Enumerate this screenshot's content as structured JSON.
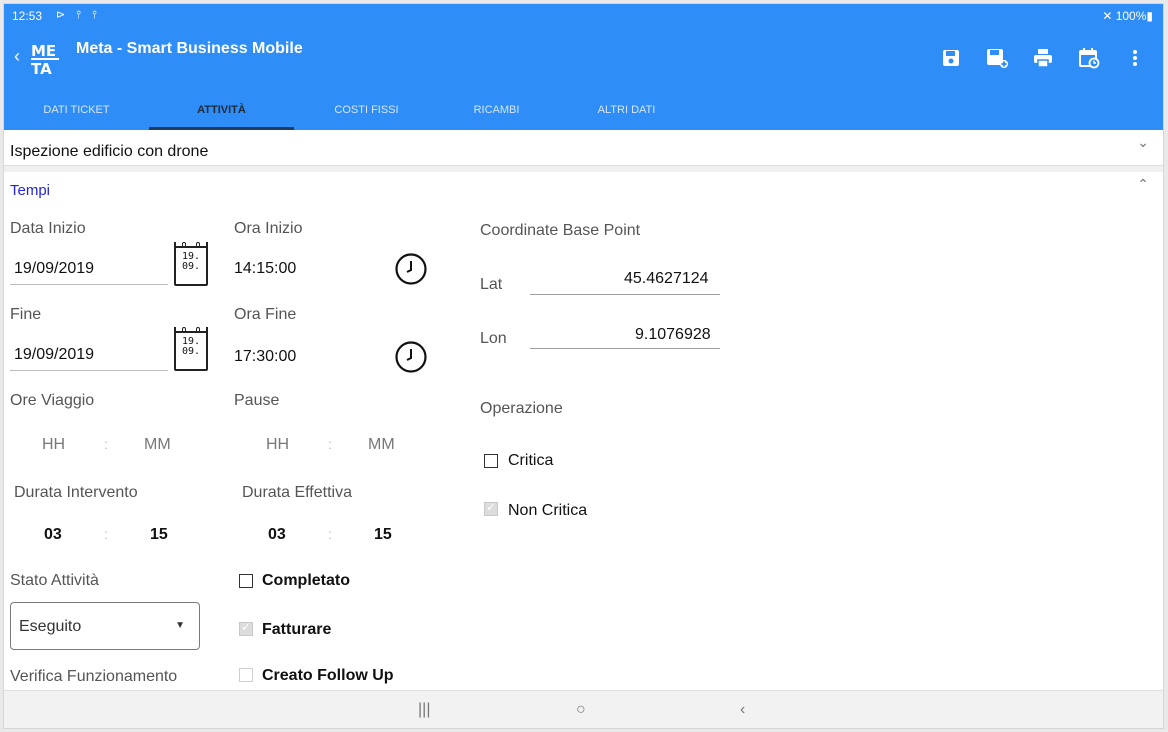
{
  "status_bar": {
    "time": "12:53",
    "icons": "⊳ ⫯ ⫯",
    "battery": "✕ 100%▮"
  },
  "app_bar": {
    "back": "‹",
    "title": "Meta - Smart Business Mobile",
    "logo_text_top": "ME",
    "logo_text_bottom": "TA"
  },
  "tabs": [
    {
      "label": "DATI TICKET"
    },
    {
      "label": "ATTIVITÀ"
    },
    {
      "label": "COSTI FISSI"
    },
    {
      "label": "RICAMBI"
    },
    {
      "label": "ALTRI DATI"
    }
  ],
  "activity_title": "Ispezione  edificio con drone",
  "section_title": "Tempi",
  "start": {
    "date_label": "Data Inizio",
    "date": "19/09/2019",
    "time_label": "Ora Inizio",
    "time": "14:15:00"
  },
  "end": {
    "date_label": "Fine",
    "date": "19/09/2019",
    "time_label": "Ora Fine",
    "time": "17:30:00"
  },
  "calendar_icon_text": {
    "day": "19.",
    "month": "09."
  },
  "travel": {
    "label": "Ore Viaggio",
    "hh": "HH",
    "sep": ":",
    "mm": "MM"
  },
  "pause": {
    "label": "Pause",
    "hh": "HH",
    "sep": ":",
    "mm": "MM"
  },
  "duration": {
    "label": "Durata Intervento",
    "hh": "03",
    "sep": ":",
    "mm": "15"
  },
  "effective": {
    "label": "Durata Effettiva",
    "hh": "03",
    "sep": ":",
    "mm": "15"
  },
  "state": {
    "label": "Stato Attività",
    "value": "Eseguito"
  },
  "checks": {
    "completato": "Completato",
    "fatturare": "Fatturare",
    "follow_up": "Creato Follow Up"
  },
  "verifica_label": "Verifica Funzionamento",
  "coords": {
    "title": "Coordinate Base Point",
    "lat_label": "Lat",
    "lat": "45.4627124",
    "lon_label": "Lon",
    "lon": "9.1076928"
  },
  "operation": {
    "title": "Operazione",
    "critica": "Critica",
    "non_critica": "Non Critica"
  },
  "navbar": {
    "recents": "|||",
    "home": "○",
    "back": "‹"
  },
  "colors": {
    "primary": "#2e8df6",
    "section_title": "#2424e0"
  }
}
